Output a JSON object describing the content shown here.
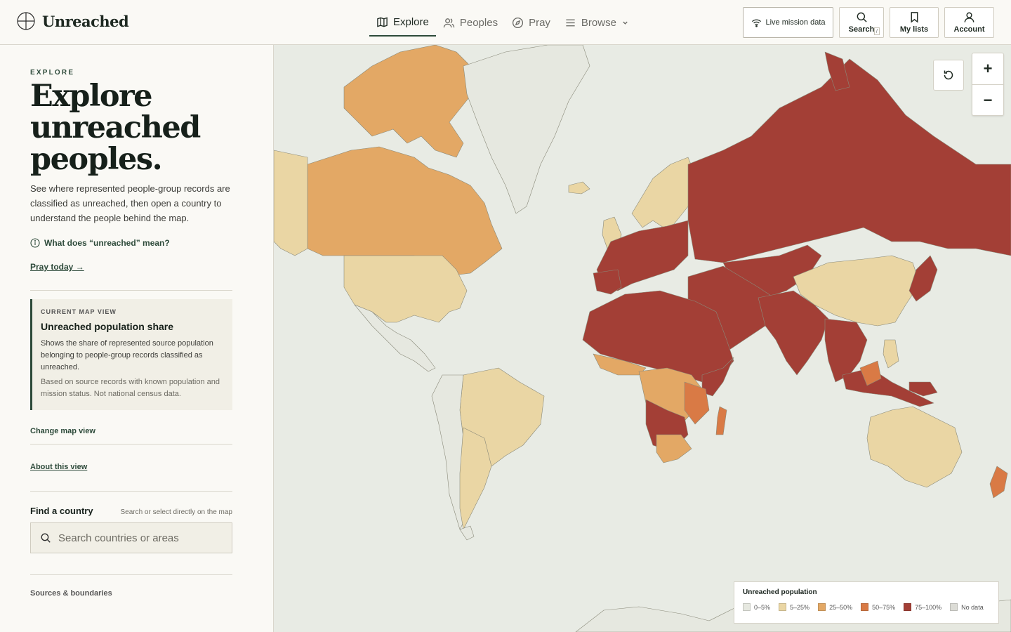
{
  "app": {
    "brand": "Unreached"
  },
  "nav": [
    {
      "label": "Explore",
      "icon": "map-icon",
      "active": true
    },
    {
      "label": "Peoples",
      "icon": "people-icon",
      "active": false
    },
    {
      "label": "Pray",
      "icon": "compass-icon",
      "active": false
    },
    {
      "label": "Browse",
      "icon": "menu-icon",
      "active": false
    }
  ],
  "tools": {
    "live": "Live mission data",
    "search": "Search",
    "search_kbd": "/",
    "lists": "My lists",
    "account": "Account"
  },
  "sidebar": {
    "eyebrow": "EXPLORE",
    "title": "Explore unreached peoples.",
    "lede": "See where represented people-group records are classified as unreached, then open a country to understand the people behind the map.",
    "what_link": "What does “unreached” mean?",
    "pray_link": "Pray today →",
    "map_view": {
      "eyebrow": "CURRENT MAP VIEW",
      "title": "Unreached population share",
      "desc": "Shows the share of represented source population belonging to people-group records classified as unreached.",
      "note": "Based on source records with known population and mission status. Not national census data."
    },
    "change_link": "Change map view",
    "about_link": "About this view",
    "find": {
      "label": "Find a country",
      "hint": "Search or select directly on the map",
      "placeholder": "Search countries or areas"
    },
    "sources_link": "Sources & boundaries"
  },
  "map": {
    "zoom_in": "+",
    "zoom_out": "−",
    "legend": {
      "title": "Unreached population",
      "items": [
        {
          "label": "0–5%",
          "color": "#e6e8e0"
        },
        {
          "label": "5–25%",
          "color": "#ead6a4"
        },
        {
          "label": "25–50%",
          "color": "#e3a865"
        },
        {
          "label": "50–75%",
          "color": "#d97a45"
        },
        {
          "label": "75–100%",
          "color": "#a33f36"
        },
        {
          "label": "No data",
          "color": "#dcdcd6"
        }
      ]
    }
  }
}
